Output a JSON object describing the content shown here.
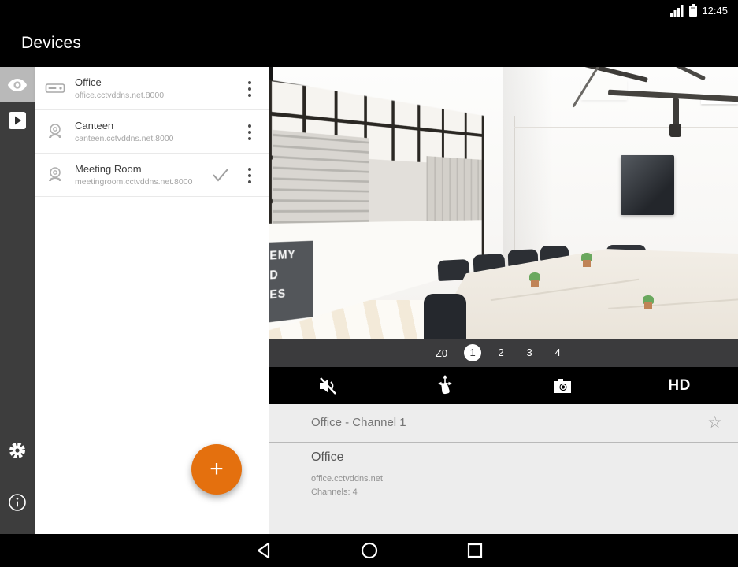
{
  "status_bar": {
    "time": "12:45",
    "icons": [
      "signal-bars-icon",
      "battery-icon"
    ]
  },
  "app_bar": {
    "title": "Devices"
  },
  "sidebar": {
    "items": [
      {
        "id": "live-view",
        "icon": "eye-icon",
        "active": true
      },
      {
        "id": "playback",
        "icon": "playback-icon",
        "active": false
      },
      {
        "id": "settings",
        "icon": "gear-icon",
        "active": false
      },
      {
        "id": "about",
        "icon": "info-icon",
        "active": false
      }
    ]
  },
  "device_list": {
    "devices": [
      {
        "name": "Office",
        "address": "office.cctvddns.net.8000",
        "icon": "dvr-icon",
        "checked": false
      },
      {
        "name": "Canteen",
        "address": "canteen.cctvddns.net.8000",
        "icon": "camera-icon",
        "checked": false
      },
      {
        "name": "Meeting Room",
        "address": "meetingroom.cctvddns.net.8000",
        "icon": "camera-icon",
        "checked": true
      }
    ],
    "fab_label": "+"
  },
  "player": {
    "channel_bar": {
      "zoom_label": "Z0",
      "channels": [
        "1",
        "2",
        "3",
        "4"
      ],
      "selected_channel": "1"
    },
    "toolbar": {
      "icons": [
        "mute-icon",
        "ptz-icon",
        "snapshot-icon"
      ],
      "quality_label": "HD"
    },
    "stream_header": {
      "title": "Office - Channel 1",
      "favorite_icon": "☆"
    },
    "device_info": {
      "name": "Office",
      "address": "office.cctvddns.net",
      "channels": "Channels: 4"
    },
    "scene": {
      "sign_lines": [
        "EMY",
        "D",
        "ES"
      ]
    }
  },
  "nav_bar": {
    "icons": [
      "back-icon",
      "home-icon",
      "recents-icon"
    ]
  },
  "colors": {
    "accent_orange": "#e4700e",
    "app_bar": "#000000",
    "sidebar": "#3d3d3d",
    "sidebar_active": "#b9b9b9",
    "channel_bar": "#3b3b3d",
    "panel_bg": "#ededed"
  }
}
